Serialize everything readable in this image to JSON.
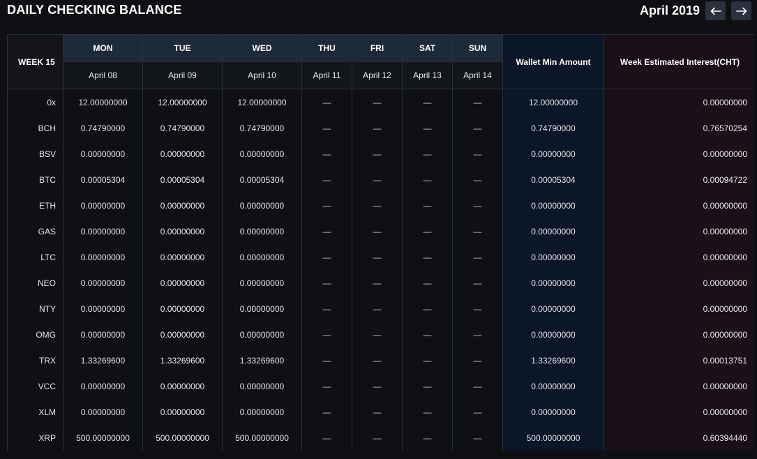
{
  "header": {
    "title": "DAILY CHECKING BALANCE",
    "month": "April 2019",
    "prev_icon": "arrow-left-icon",
    "next_icon": "arrow-right-icon"
  },
  "table": {
    "week_label": "WEEK 15",
    "days": [
      {
        "name": "MON",
        "date": "April 08"
      },
      {
        "name": "TUE",
        "date": "April 09"
      },
      {
        "name": "WED",
        "date": "April 10"
      },
      {
        "name": "THU",
        "date": "April 11"
      },
      {
        "name": "FRI",
        "date": "April 12"
      },
      {
        "name": "SAT",
        "date": "April 13"
      },
      {
        "name": "SUN",
        "date": "April 14"
      }
    ],
    "wallet_header": "Wallet Min Amount",
    "interest_header": "Week Estimated Interest(CHT)",
    "rows": [
      {
        "symbol": "0x",
        "values": [
          "12.00000000",
          "12.00000000",
          "12.00000000",
          "—",
          "—",
          "—",
          "—"
        ],
        "wallet": "12.00000000",
        "interest": "0.00000000"
      },
      {
        "symbol": "BCH",
        "values": [
          "0.74790000",
          "0.74790000",
          "0.74790000",
          "—",
          "—",
          "—",
          "—"
        ],
        "wallet": "0.74790000",
        "interest": "0.76570254"
      },
      {
        "symbol": "BSV",
        "values": [
          "0.00000000",
          "0.00000000",
          "0.00000000",
          "—",
          "—",
          "—",
          "—"
        ],
        "wallet": "0.00000000",
        "interest": "0.00000000"
      },
      {
        "symbol": "BTC",
        "values": [
          "0.00005304",
          "0.00005304",
          "0.00005304",
          "—",
          "—",
          "—",
          "—"
        ],
        "wallet": "0.00005304",
        "interest": "0.00094722"
      },
      {
        "symbol": "ETH",
        "values": [
          "0.00000000",
          "0.00000000",
          "0.00000000",
          "—",
          "—",
          "—",
          "—"
        ],
        "wallet": "0.00000000",
        "interest": "0.00000000"
      },
      {
        "symbol": "GAS",
        "values": [
          "0.00000000",
          "0.00000000",
          "0.00000000",
          "—",
          "—",
          "—",
          "—"
        ],
        "wallet": "0.00000000",
        "interest": "0.00000000"
      },
      {
        "symbol": "LTC",
        "values": [
          "0.00000000",
          "0.00000000",
          "0.00000000",
          "—",
          "—",
          "—",
          "—"
        ],
        "wallet": "0.00000000",
        "interest": "0.00000000"
      },
      {
        "symbol": "NEO",
        "values": [
          "0.00000000",
          "0.00000000",
          "0.00000000",
          "—",
          "—",
          "—",
          "—"
        ],
        "wallet": "0.00000000",
        "interest": "0.00000000"
      },
      {
        "symbol": "NTY",
        "values": [
          "0.00000000",
          "0.00000000",
          "0.00000000",
          "—",
          "—",
          "—",
          "—"
        ],
        "wallet": "0.00000000",
        "interest": "0.00000000"
      },
      {
        "symbol": "OMG",
        "values": [
          "0.00000000",
          "0.00000000",
          "0.00000000",
          "—",
          "—",
          "—",
          "—"
        ],
        "wallet": "0.00000000",
        "interest": "0.00000000"
      },
      {
        "symbol": "TRX",
        "values": [
          "1.33269600",
          "1.33269600",
          "1.33269600",
          "—",
          "—",
          "—",
          "—"
        ],
        "wallet": "1.33269600",
        "interest": "0.00013751"
      },
      {
        "symbol": "VCC",
        "values": [
          "0.00000000",
          "0.00000000",
          "0.00000000",
          "—",
          "—",
          "—",
          "—"
        ],
        "wallet": "0.00000000",
        "interest": "0.00000000"
      },
      {
        "symbol": "XLM",
        "values": [
          "0.00000000",
          "0.00000000",
          "0.00000000",
          "—",
          "—",
          "—",
          "—"
        ],
        "wallet": "0.00000000",
        "interest": "0.00000000"
      },
      {
        "symbol": "XRP",
        "values": [
          "500.00000000",
          "500.00000000",
          "500.00000000",
          "—",
          "—",
          "—",
          "—"
        ],
        "wallet": "500.00000000",
        "interest": "0.60394440"
      }
    ]
  },
  "colors": {
    "background": "#0f1014",
    "day_header": "#1e2a3a",
    "wallet_column": "#0b1628",
    "interest_column": "#1b0f1a",
    "nav_button": "#2a3240"
  }
}
